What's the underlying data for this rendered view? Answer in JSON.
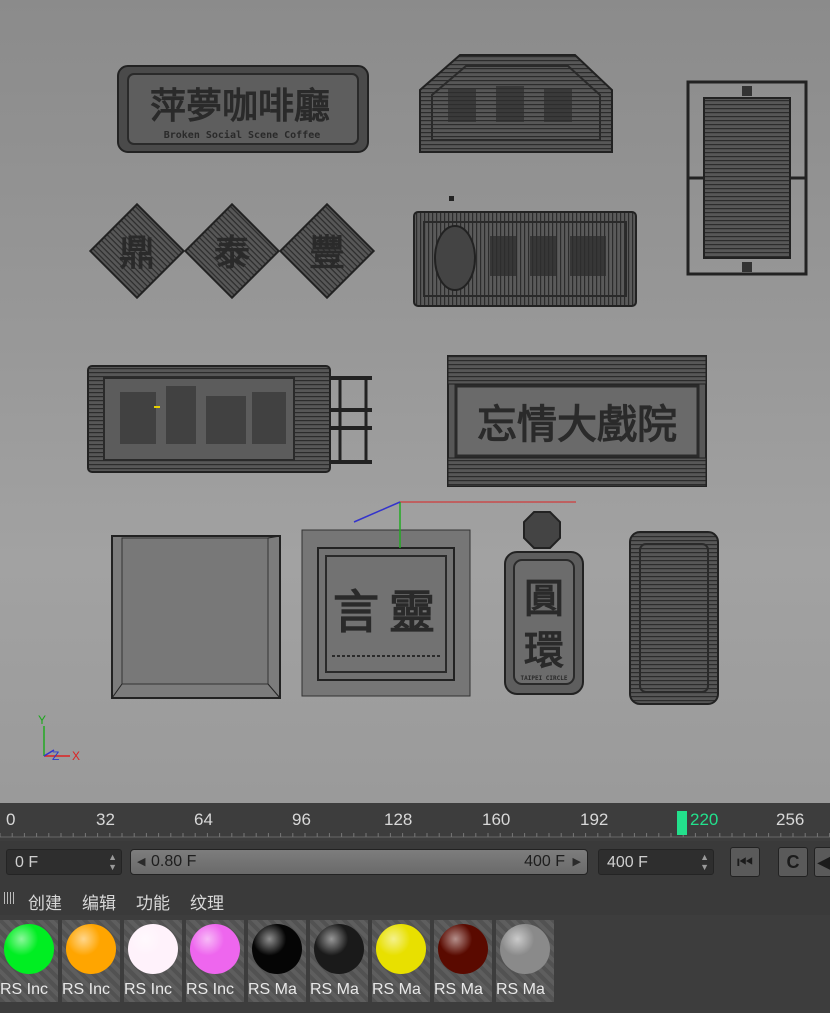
{
  "viewport": {
    "signs": {
      "sign1_title": "萍夢咖啡廳",
      "sign1_subtitle": "Broken Social Scene Coffee",
      "sign3_chars": [
        "鼎",
        "泰",
        "豐"
      ],
      "sign6_title": "忘情大戲院",
      "sign7_char_a": "言",
      "sign7_char_b": "靈",
      "sign8_char_a": "圓",
      "sign8_char_b": "環",
      "sign8_small": "TAIPEI CIRCLE"
    },
    "axis_gizmo": {
      "y": "Y",
      "z": "Z",
      "x": "X"
    }
  },
  "timeline": {
    "ticks": [
      "0",
      "32",
      "64",
      "96",
      "128",
      "160",
      "192",
      "256"
    ],
    "playhead": "220"
  },
  "controls": {
    "start_frame": "0 F",
    "range_start": "0.80 F",
    "range_end": "400 F",
    "end_frame": "400 F",
    "btn_first": "⏮",
    "btn_loop": "C"
  },
  "menu": {
    "items": [
      "创建",
      "编辑",
      "功能",
      "纹理"
    ]
  },
  "materials": [
    {
      "label": "RS Inc",
      "color": "#00ee22"
    },
    {
      "label": "RS Inc",
      "color": "#ffa500"
    },
    {
      "label": "RS Inc",
      "color": "#fff2fb"
    },
    {
      "label": "RS Inc",
      "color": "#ee66ee"
    },
    {
      "label": "RS Ma",
      "color": "#050505"
    },
    {
      "label": "RS Ma",
      "color": "#1a1a1a"
    },
    {
      "label": "RS Ma",
      "color": "#e8e000"
    },
    {
      "label": "RS Ma",
      "color": "#5a0a00"
    },
    {
      "label": "RS Ma",
      "color": "#8a8a8a"
    }
  ]
}
